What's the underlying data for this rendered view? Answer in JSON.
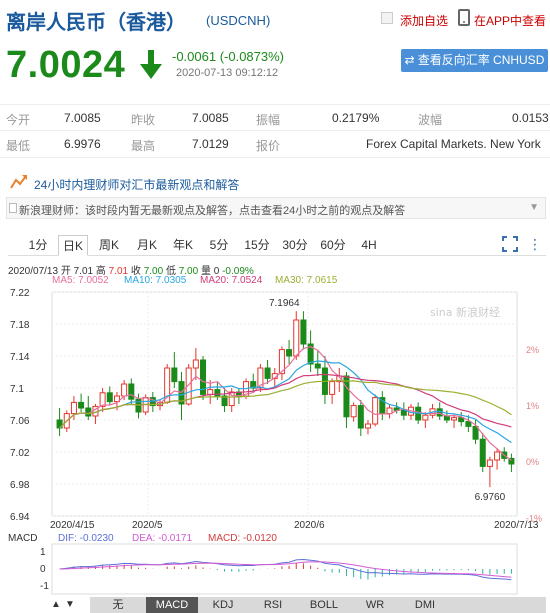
{
  "header": {
    "title": "离岸人民币（香港）",
    "code": "(USDCNH)",
    "add_favorite": "添加自选",
    "app_view": "在APP中查看"
  },
  "quote": {
    "price": "7.0024",
    "change": "-0.0061 (-0.0873%)",
    "timestamp": "2020-07-13 09:12:12",
    "reverse_button": "查看反向汇率 CNHUSD",
    "color_down": "#1b8a1b",
    "color_up": "#e5352b"
  },
  "stats": {
    "open_label": "今开",
    "open": "7.0085",
    "prev_label": "昨收",
    "prev": "7.0085",
    "amp_label": "振幅",
    "amp": "0.2179%",
    "wave_label": "波幅",
    "wave": "0.0153",
    "low_label": "最低",
    "low": "6.9976",
    "high_label": "最高",
    "high": "7.0129",
    "quote_label": "报价",
    "quote_src": "Forex Capital Markets. New York"
  },
  "news": {
    "headline": "24小时内理财师对汇市最新观点和解答",
    "sub": "新浪理财师：该时段内暂无最新观点及解答，点击查看24小时之前的观点及解答"
  },
  "tabs": [
    "1分",
    "日K",
    "周K",
    "月K",
    "年K",
    "5分",
    "15分",
    "30分",
    "60分",
    "4H"
  ],
  "active_tab": "日K",
  "chart_info": {
    "date": "2020/07/13",
    "open_label": "开",
    "open": "7.01",
    "high_label": "高",
    "high": "7.01",
    "close_label": "收",
    "close": "7.00",
    "low_label": "低",
    "low": "7.00",
    "vol_label": "量",
    "vol": "0",
    "pct": "-0.09%",
    "ma5": "MA5: 7.0052",
    "ma10": "MA10: 7.0305",
    "ma20": "MA20: 7.0524",
    "ma30": "MA30: 7.0615",
    "watermark": "新浪财经"
  },
  "chart_data": {
    "type": "candlestick",
    "y_ticks": [
      "7.22",
      "7.18",
      "7.14",
      "7.1",
      "7.06",
      "7.02",
      "6.98",
      "6.94"
    ],
    "pct_ticks": [
      "2%",
      "1%",
      "0%",
      "-1%"
    ],
    "x_ticks": [
      "2020/4/15",
      "2020/5",
      "2020/6",
      "2020/7/13"
    ],
    "max_label": "7.1964",
    "min_label": "6.9760",
    "ylim": [
      6.94,
      7.22
    ],
    "ma_colors": {
      "ma5": "#e86fa0",
      "ma10": "#2aa6e0",
      "ma20": "#d13c7a",
      "ma30": "#9bb032"
    },
    "candles": [
      [
        7.06,
        7.075,
        7.04,
        7.05
      ],
      [
        7.05,
        7.072,
        7.045,
        7.068
      ],
      [
        7.068,
        7.09,
        7.06,
        7.082
      ],
      [
        7.082,
        7.093,
        7.07,
        7.075
      ],
      [
        7.075,
        7.09,
        7.06,
        7.065
      ],
      [
        7.065,
        7.08,
        7.055,
        7.077
      ],
      [
        7.077,
        7.1,
        7.07,
        7.094
      ],
      [
        7.094,
        7.102,
        7.078,
        7.083
      ],
      [
        7.083,
        7.095,
        7.072,
        7.09
      ],
      [
        7.09,
        7.11,
        7.085,
        7.105
      ],
      [
        7.105,
        7.112,
        7.08,
        7.086
      ],
      [
        7.086,
        7.093,
        7.062,
        7.07
      ],
      [
        7.07,
        7.092,
        7.066,
        7.088
      ],
      [
        7.088,
        7.095,
        7.07,
        7.078
      ],
      [
        7.078,
        7.086,
        7.072,
        7.082
      ],
      [
        7.082,
        7.13,
        7.08,
        7.125
      ],
      [
        7.125,
        7.145,
        7.1,
        7.108
      ],
      [
        7.108,
        7.12,
        7.06,
        7.08
      ],
      [
        7.08,
        7.13,
        7.078,
        7.125
      ],
      [
        7.125,
        7.15,
        7.11,
        7.135
      ],
      [
        7.135,
        7.14,
        7.085,
        7.092
      ],
      [
        7.092,
        7.11,
        7.08,
        7.098
      ],
      [
        7.098,
        7.108,
        7.085,
        7.09
      ],
      [
        7.09,
        7.1,
        7.07,
        7.078
      ],
      [
        7.078,
        7.1,
        7.07,
        7.095
      ],
      [
        7.095,
        7.1,
        7.08,
        7.09
      ],
      [
        7.09,
        7.112,
        7.086,
        7.108
      ],
      [
        7.108,
        7.118,
        7.094,
        7.1
      ],
      [
        7.1,
        7.13,
        7.095,
        7.125
      ],
      [
        7.125,
        7.135,
        7.105,
        7.112
      ],
      [
        7.112,
        7.125,
        7.1,
        7.118
      ],
      [
        7.118,
        7.152,
        7.11,
        7.148
      ],
      [
        7.148,
        7.16,
        7.13,
        7.14
      ],
      [
        7.14,
        7.196,
        7.135,
        7.185
      ],
      [
        7.185,
        7.196,
        7.148,
        7.155
      ],
      [
        7.155,
        7.172,
        7.12,
        7.13
      ],
      [
        7.13,
        7.148,
        7.115,
        7.125
      ],
      [
        7.125,
        7.14,
        7.08,
        7.092
      ],
      [
        7.092,
        7.112,
        7.08,
        7.108
      ],
      [
        7.108,
        7.125,
        7.095,
        7.115
      ],
      [
        7.115,
        7.12,
        7.05,
        7.064
      ],
      [
        7.064,
        7.082,
        7.058,
        7.078
      ],
      [
        7.078,
        7.085,
        7.04,
        7.05
      ],
      [
        7.05,
        7.06,
        7.042,
        7.055
      ],
      [
        7.055,
        7.092,
        7.052,
        7.088
      ],
      [
        7.088,
        7.096,
        7.06,
        7.068
      ],
      [
        7.068,
        7.08,
        7.062,
        7.075
      ],
      [
        7.075,
        7.082,
        7.068,
        7.072
      ],
      [
        7.072,
        7.082,
        7.06,
        7.066
      ],
      [
        7.066,
        7.08,
        7.06,
        7.076
      ],
      [
        7.076,
        7.082,
        7.055,
        7.06
      ],
      [
        7.06,
        7.07,
        7.05,
        7.066
      ],
      [
        7.066,
        7.08,
        7.062,
        7.074
      ],
      [
        7.074,
        7.082,
        7.06,
        7.065
      ],
      [
        7.065,
        7.072,
        7.056,
        7.06
      ],
      [
        7.06,
        7.068,
        7.05,
        7.063
      ],
      [
        7.063,
        7.07,
        7.052,
        7.058
      ],
      [
        7.058,
        7.066,
        7.045,
        7.052
      ],
      [
        7.052,
        7.06,
        7.03,
        7.036
      ],
      [
        7.036,
        7.044,
        6.995,
        7.002
      ],
      [
        7.002,
        7.014,
        6.976,
        7.01
      ],
      [
        7.01,
        7.025,
        6.998,
        7.02
      ],
      [
        7.02,
        7.026,
        7.008,
        7.012
      ],
      [
        7.012,
        7.018,
        6.995,
        7.005
      ]
    ],
    "macd_legend": {
      "dif": "DIF: -0.0230",
      "dea": "DEA: -0.0171",
      "macd": "MACD: -0.0120"
    },
    "macd_ticks": [
      "1",
      "0",
      "-1"
    ],
    "macd_colors": {
      "dif": "#5b6fd6",
      "dea": "#d45ad4",
      "macd": "#d13c3c"
    }
  },
  "bottom_tabs": [
    "无",
    "MACD",
    "KDJ",
    "RSI",
    "BOLL",
    "WR",
    "DMI"
  ],
  "bottom_active": "MACD"
}
